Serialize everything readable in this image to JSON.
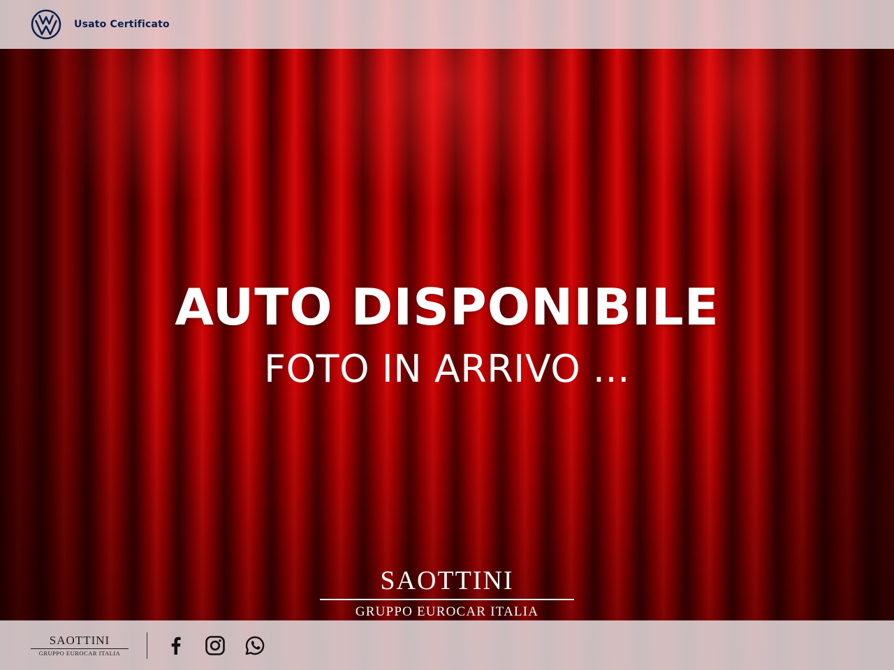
{
  "header": {
    "brand_label": "Usato Certificato",
    "logo_icon": "vw-logo-icon",
    "logo_color": "#0b1f4d"
  },
  "hero": {
    "headline": "AUTO DISPONIBILE",
    "subheadline": "FOTO IN ARRIVO ...",
    "background": "red-curtain",
    "accent_color": "#c00000"
  },
  "dealer_logo": {
    "name": "SAOTTINI",
    "group": "GRUPPO EUROCAR ITALIA"
  },
  "footer": {
    "logo_name": "SAOTTINI",
    "logo_group": "GRUPPO EUROCAR ITALIA",
    "social": [
      {
        "icon": "facebook-icon"
      },
      {
        "icon": "instagram-icon"
      },
      {
        "icon": "whatsapp-icon"
      }
    ]
  }
}
